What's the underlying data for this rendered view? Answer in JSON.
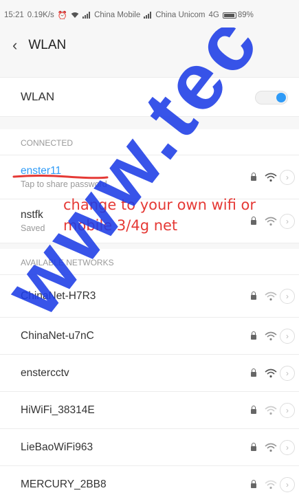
{
  "status_bar": {
    "time": "15:21",
    "speed": "0.19K/s",
    "carrier1": "China Mobile",
    "carrier2": "China Unicom",
    "network_type": "4G",
    "battery": "89%"
  },
  "header": {
    "title": "WLAN",
    "back_icon": "back-arrow-icon"
  },
  "wlan_toggle": {
    "label": "WLAN",
    "on": true,
    "accent_color": "#2f9bf7"
  },
  "connected": {
    "section_label": "CONNECTED",
    "networks": [
      {
        "name": "enster11",
        "sub": "Tap to share password"
      },
      {
        "name": "nstfk",
        "sub": "Saved"
      }
    ]
  },
  "available": {
    "section_label": "AVAILABLE NETWORKS",
    "networks": [
      {
        "name": "ChinaNet-H7R3"
      },
      {
        "name": "ChinaNet-u7nC"
      },
      {
        "name": "enstercctv"
      },
      {
        "name": "HiWiFi_38314E"
      },
      {
        "name": "LieBaoWiFi963"
      },
      {
        "name": "MERCURY_2BB8"
      }
    ]
  },
  "annotation": {
    "line1": "change to your own wifi or",
    "line2": "mobile 3/4g net",
    "color": "#e53935"
  },
  "watermark": {
    "text": "www.tec"
  }
}
